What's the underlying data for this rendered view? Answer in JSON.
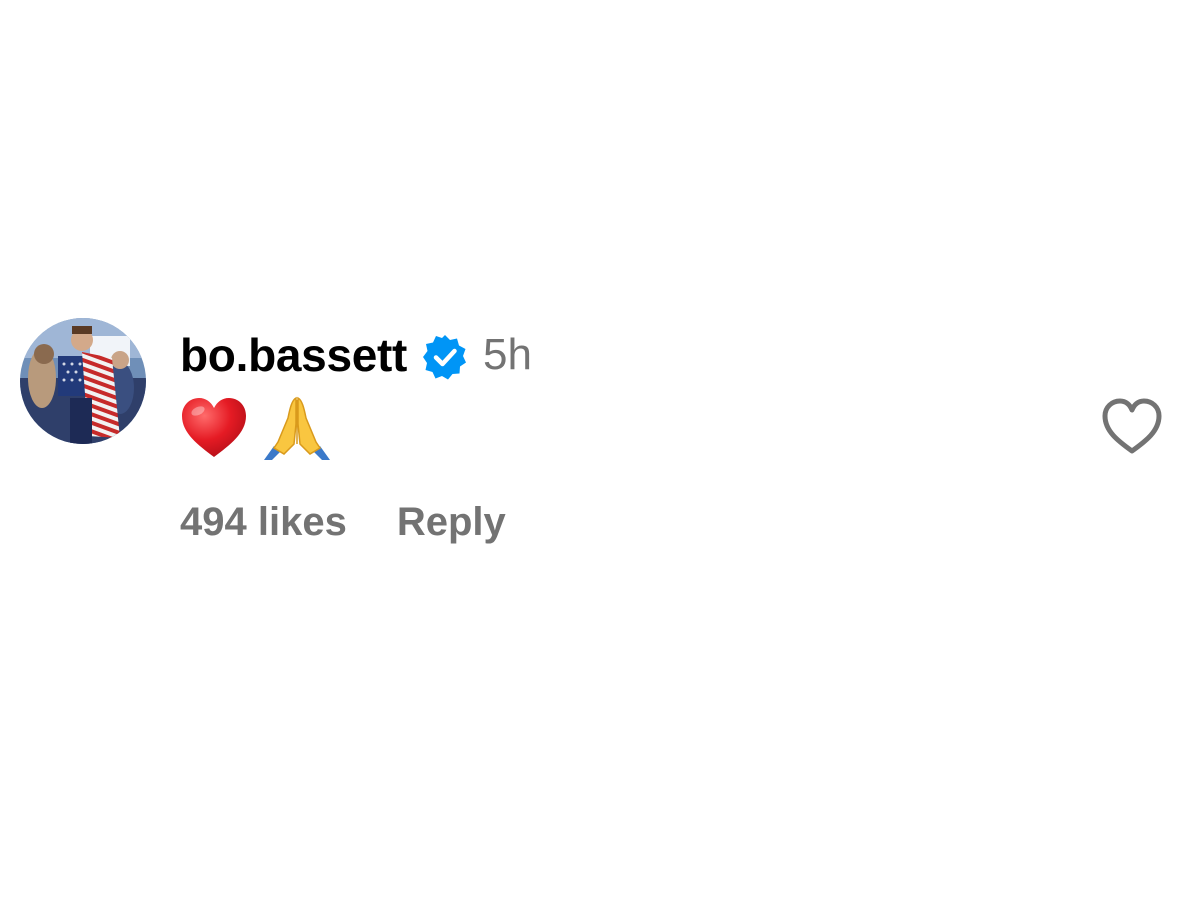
{
  "comment": {
    "username": "bo.bassett",
    "verified": true,
    "time": "5h",
    "emojis": [
      "❤️",
      "🙏"
    ],
    "likes": "494 likes",
    "reply_label": "Reply"
  },
  "icons": {
    "avatar": "user-avatar-photo",
    "verified": "verified-badge-icon",
    "like": "heart-outline-icon"
  },
  "colors": {
    "username": "#000000",
    "meta": "#737373",
    "verified": "#0095F6",
    "heart_emoji": "#E0202F",
    "like_outline": "#737373"
  }
}
